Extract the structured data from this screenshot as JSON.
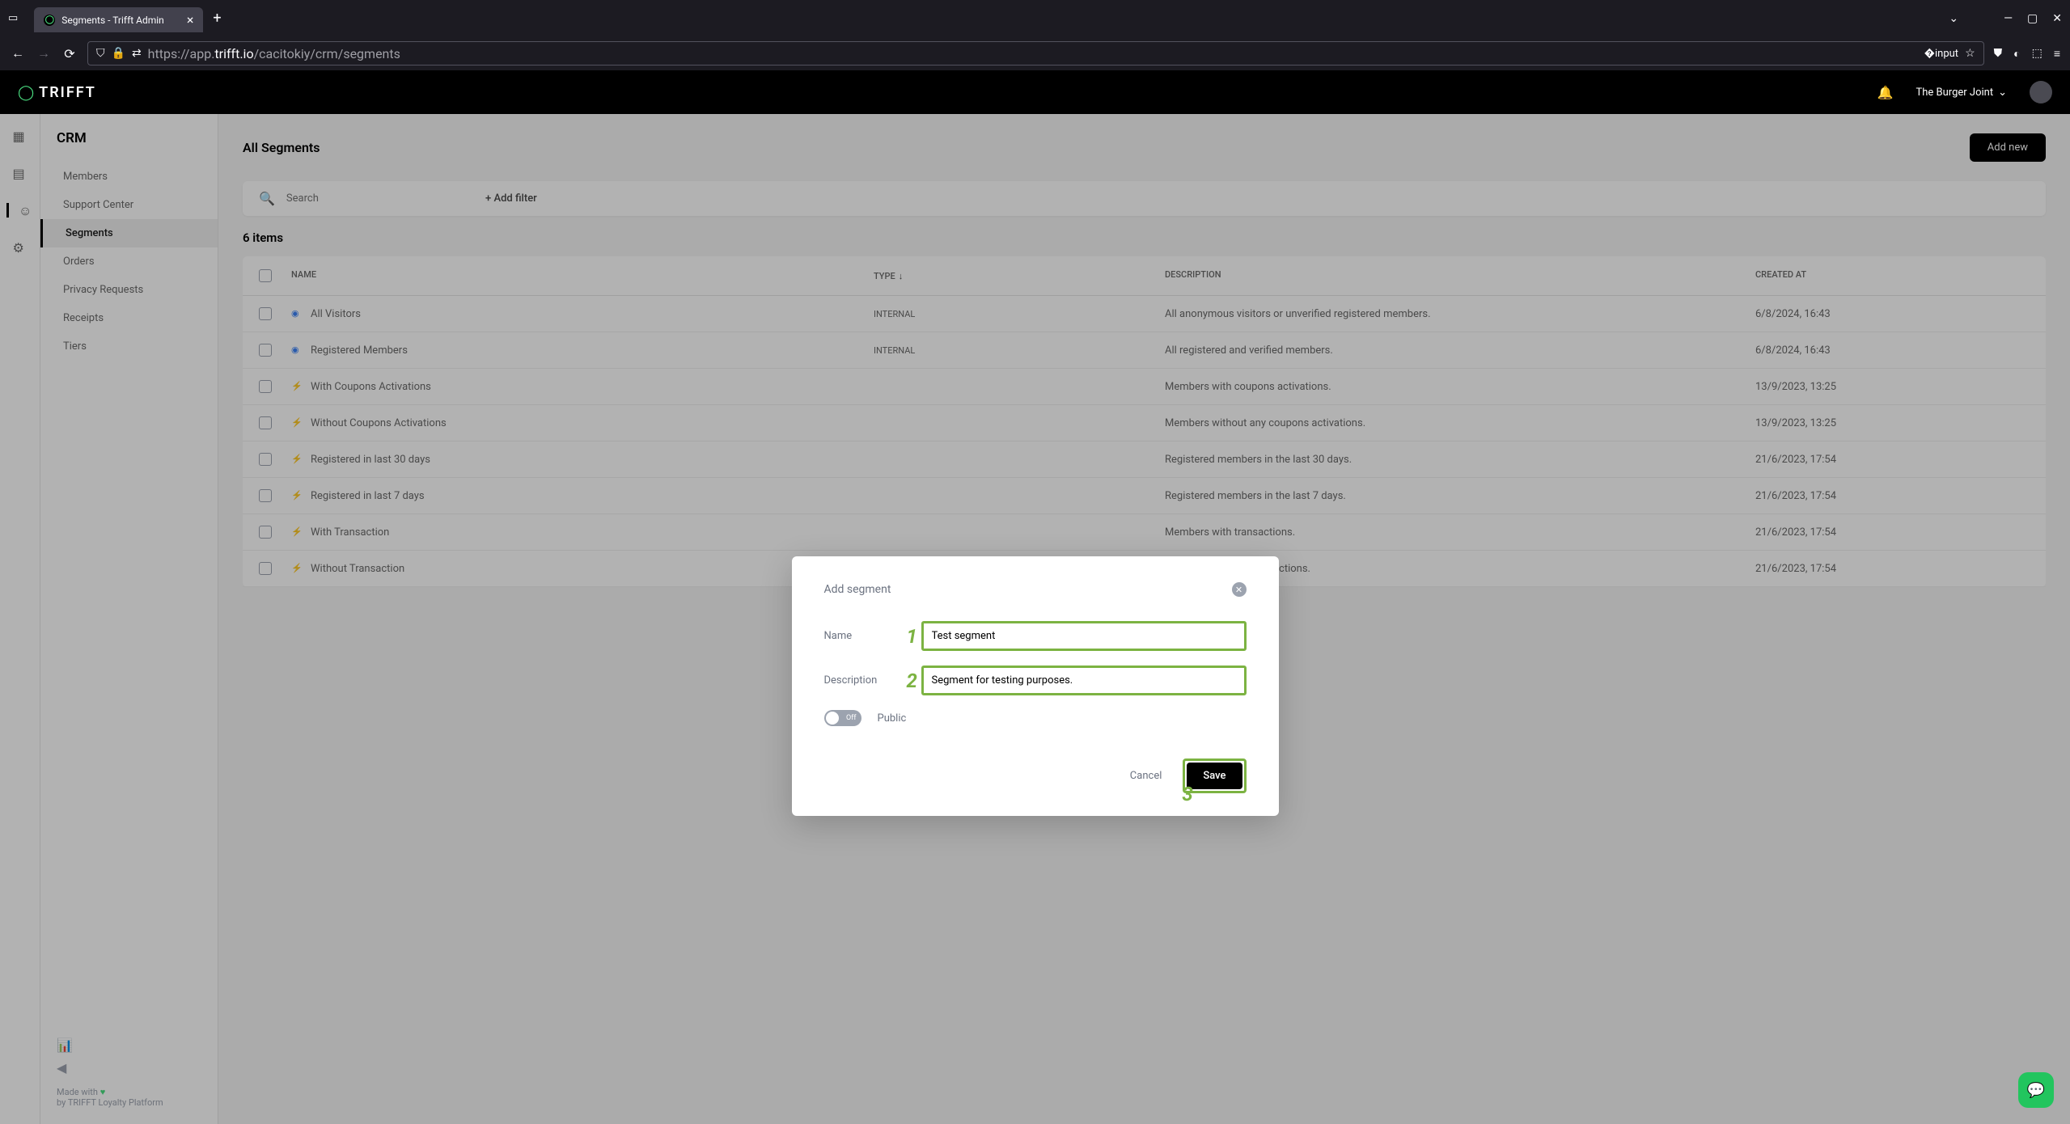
{
  "browser": {
    "tab_title": "Segments - Trifft Admin",
    "url_prefix": "https://app.",
    "url_domain": "trifft.io",
    "url_path": "/cacitokiy/crm/segments"
  },
  "header": {
    "logo": "TRIFFT",
    "org": "The Burger Joint"
  },
  "sidebar": {
    "title": "CRM",
    "items": [
      "Members",
      "Support Center",
      "Segments",
      "Orders",
      "Privacy Requests",
      "Receipts",
      "Tiers"
    ],
    "made_with": "Made with",
    "by_line": "by TRIFFT Loyalty Platform"
  },
  "page": {
    "title": "All Segments",
    "add_new": "Add new",
    "search_placeholder": "Search",
    "add_filter": "+ Add filter",
    "items_count": "6 items"
  },
  "table": {
    "headers": {
      "name": "NAME",
      "type": "TYPE",
      "desc": "DESCRIPTION",
      "created": "CREATED AT"
    },
    "rows": [
      {
        "icon": "blue",
        "name": "All Visitors",
        "type": "INTERNAL",
        "desc": "All anonymous visitors or unverified registered members.",
        "created": "6/8/2024, 16:43"
      },
      {
        "icon": "blue",
        "name": "Registered Members",
        "type": "INTERNAL",
        "desc": "All registered and verified members.",
        "created": "6/8/2024, 16:43"
      },
      {
        "icon": "orange",
        "name": "With Coupons Activations",
        "type": "",
        "desc": "Members with coupons activations.",
        "created": "13/9/2023, 13:25"
      },
      {
        "icon": "orange",
        "name": "Without Coupons Activations",
        "type": "",
        "desc": "Members without any coupons activations.",
        "created": "13/9/2023, 13:25"
      },
      {
        "icon": "orange",
        "name": "Registered in last 30 days",
        "type": "",
        "desc": "Registered members in the last 30 days.",
        "created": "21/6/2023, 17:54"
      },
      {
        "icon": "orange",
        "name": "Registered in last 7 days",
        "type": "",
        "desc": "Registered members in the last 7 days.",
        "created": "21/6/2023, 17:54"
      },
      {
        "icon": "orange",
        "name": "With Transaction",
        "type": "",
        "desc": "Members with transactions.",
        "created": "21/6/2023, 17:54"
      },
      {
        "icon": "orange",
        "name": "Without Transaction",
        "type": "",
        "desc": "Members without transactions.",
        "created": "21/6/2023, 17:54"
      }
    ]
  },
  "modal": {
    "title": "Add segment",
    "name_label": "Name",
    "name_value": "Test segment",
    "desc_label": "Description",
    "desc_value": "Segment for testing purposes.",
    "toggle_off": "Off",
    "public_label": "Public",
    "cancel": "Cancel",
    "save": "Save",
    "step1": "1",
    "step2": "2",
    "step3": "3"
  }
}
